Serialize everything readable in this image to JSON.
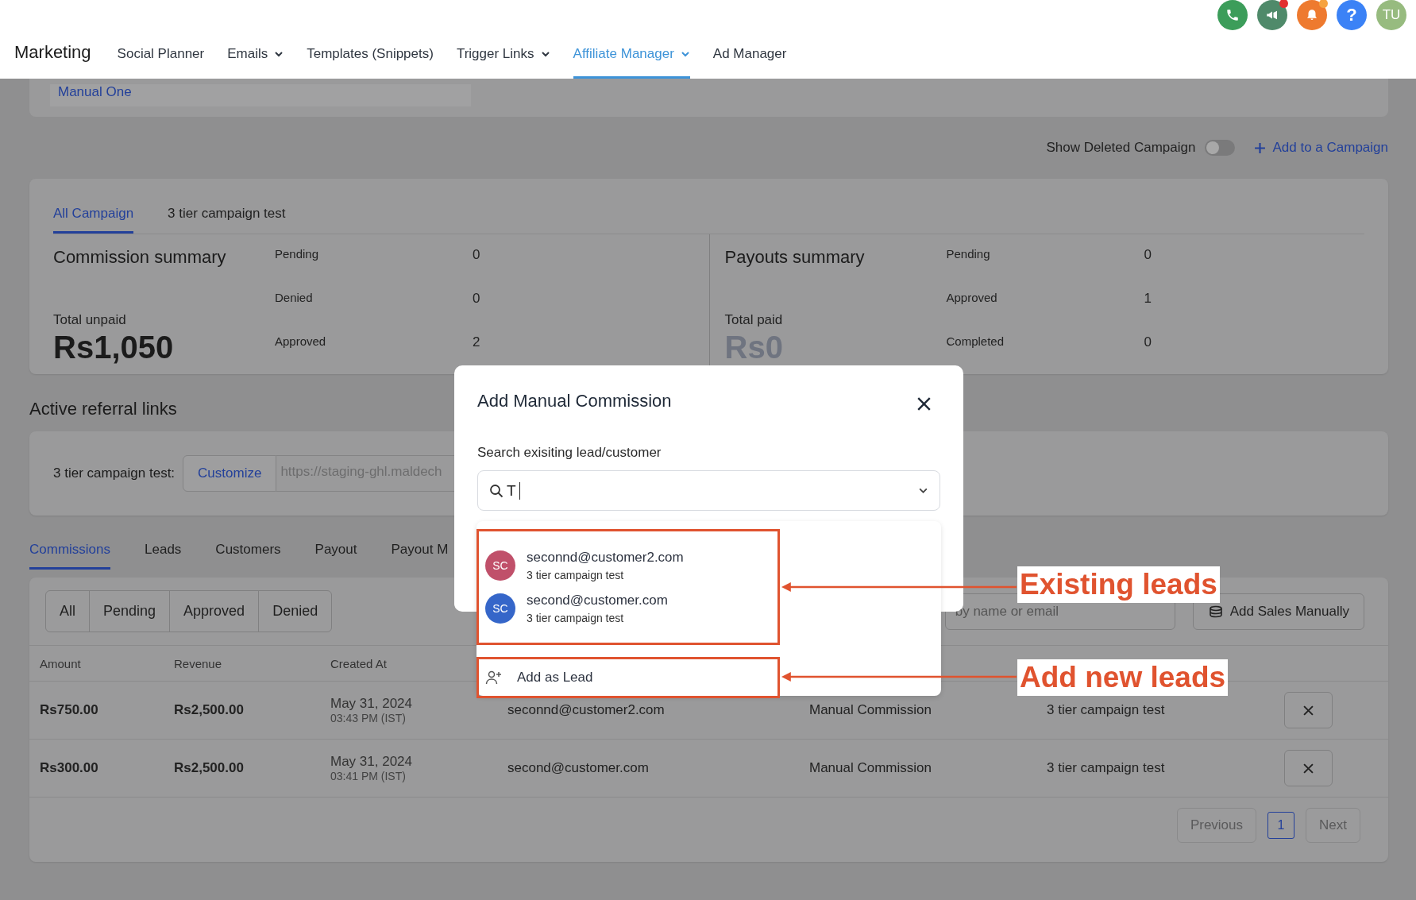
{
  "topbar": {
    "help": "?",
    "avatar": "TU",
    "alerts": [
      {
        "kind": "phone",
        "color": "#3c9d5a",
        "dot": false
      },
      {
        "kind": "megaphone",
        "color": "#4f8a6a",
        "dot": true
      },
      {
        "kind": "bell",
        "color": "#ee7a2f",
        "dot": true
      }
    ]
  },
  "nav": {
    "title": "Marketing",
    "items": [
      {
        "label": "Social Planner",
        "selected": false,
        "menu": false
      },
      {
        "label": "Emails",
        "selected": false,
        "menu": true
      },
      {
        "label": "Templates (Snippets)",
        "selected": false,
        "menu": false
      },
      {
        "label": "Trigger Links",
        "selected": false,
        "menu": true
      },
      {
        "label": "Affiliate Manager",
        "selected": true,
        "menu": true
      },
      {
        "label": "Ad Manager",
        "selected": false,
        "menu": false
      }
    ]
  },
  "summary_strip": {
    "name": "Manual One"
  },
  "campaign_actions": {
    "show_deleted": {
      "label": "Show Deleted Campaign",
      "on": false
    },
    "add_button": "Add to a Campaign"
  },
  "campaign_card": {
    "tabs": [
      {
        "label": "All Campaign",
        "selected": true
      },
      {
        "label": "3 tier campaign test",
        "selected": false
      }
    ],
    "sections": [
      {
        "title": "Commission summary",
        "total_label": "Total unpaid",
        "total": "Rs1,050",
        "muted": false,
        "rows": [
          {
            "label": "Pending",
            "value": "0"
          },
          {
            "label": "Denied",
            "value": "0"
          },
          {
            "label": "Approved",
            "value": "2"
          }
        ]
      },
      {
        "title": "Payouts summary",
        "total_label": "Total paid",
        "total": "Rs0",
        "muted": true,
        "rows": [
          {
            "label": "Pending",
            "value": "0"
          },
          {
            "label": "Approved",
            "value": "1"
          },
          {
            "label": "Completed",
            "value": "0"
          }
        ]
      }
    ]
  },
  "referral": {
    "title": "Active referral links",
    "links": [
      {
        "label": "3 tier campaign test:",
        "button": "Customize",
        "url": "https://staging-ghl.maldech"
      }
    ]
  },
  "section_tabs": [
    {
      "label": "Commissions",
      "selected": true
    },
    {
      "label": "Leads",
      "selected": false
    },
    {
      "label": "Customers",
      "selected": false
    },
    {
      "label": "Payout",
      "selected": false
    },
    {
      "label": "Payout M",
      "selected": false
    }
  ],
  "filters": [
    {
      "label": "All",
      "selected": false
    },
    {
      "label": "Pending",
      "selected": false
    },
    {
      "label": "Approved",
      "selected": false
    },
    {
      "label": "Denied",
      "selected": false
    }
  ],
  "search": {
    "placeholder": "by name or email"
  },
  "add_sales_button": "Add Sales Manually",
  "table": {
    "columns": [
      "Amount",
      "Revenue",
      "Created At"
    ],
    "rows": [
      {
        "amount": "Rs750.00",
        "revenue": "Rs2,500.00",
        "date": "May 31, 2024",
        "time": "03:43 PM (IST)",
        "email": "seconnd@customer2.com",
        "type": "Manual Commission",
        "campaign": "3 tier campaign test"
      },
      {
        "amount": "Rs300.00",
        "revenue": "Rs2,500.00",
        "date": "May 31, 2024",
        "time": "03:41 PM (IST)",
        "email": "second@customer.com",
        "type": "Manual Commission",
        "campaign": "3 tier campaign test"
      }
    ]
  },
  "pagination": {
    "previous": "Previous",
    "pages": [
      {
        "label": "1",
        "selected": true
      }
    ],
    "next": "Next"
  },
  "modal": {
    "title": "Add Manual Commission",
    "search_label": "Search exisiting lead/customer",
    "search_value": "T",
    "options": [
      {
        "initials": "SC",
        "color": "#c0506a",
        "email": "seconnd@customer2.com",
        "campaign": "3 tier campaign test"
      },
      {
        "initials": "SC",
        "color": "#3566c9",
        "email": "second@customer.com",
        "campaign": "3 tier campaign test"
      }
    ],
    "add_option": "Add as Lead"
  },
  "annotations": [
    {
      "label": "Existing leads"
    },
    {
      "label": "Add new leads"
    }
  ]
}
